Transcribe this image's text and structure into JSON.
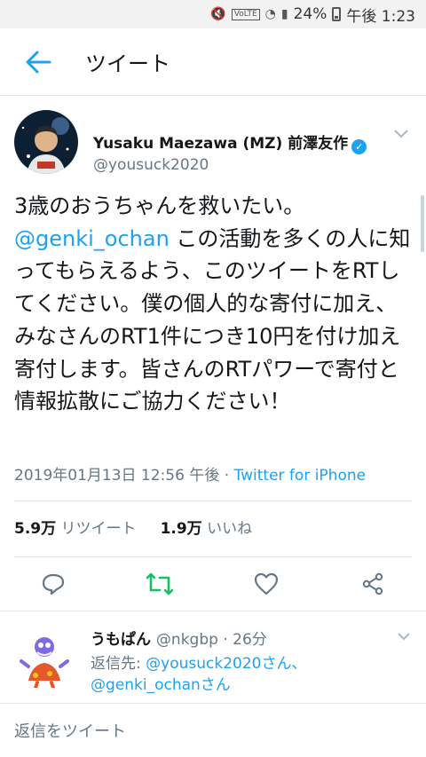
{
  "status_bar": {
    "battery": "24%",
    "time": "午後 1:23",
    "network": "VoLTE"
  },
  "app_bar": {
    "title": "ツイート"
  },
  "tweet": {
    "author_name": "Yusaku Maezawa (MZ) 前澤友作",
    "author_handle": "@yousuck2020",
    "text_line1": "3歳のおうちゃんを救いたい。",
    "mention": "@genki_ochan",
    "text_rest": " この活動を多くの人に知ってもらえるよう、このツイートをRTしてください。僕の個人的な寄付に加え、みなさんのRT1件につき10円を付け加え寄付します。皆さんのRTパワーで寄付と情報拡散にご協力ください！",
    "timestamp": "2019年01月13日 12:56 午後",
    "separator": " · ",
    "source": "Twitter for iPhone",
    "retweet_count": "5.9万",
    "retweet_label": "リツイート",
    "like_count": "1.9万",
    "like_label": "いいね"
  },
  "reply": {
    "name": "うもぱん",
    "handle": "@nkgbp",
    "time": " · 26分",
    "reply_to_label": "返信先: ",
    "reply_to_user1": "@yousuck2020さん、",
    "reply_to_user2": "@genki_ochanさん"
  },
  "composer": {
    "placeholder": "返信をツイート"
  },
  "colors": {
    "accent": "#1da1f2",
    "retweet_green": "#17bf63",
    "secondary_text": "#657786"
  }
}
